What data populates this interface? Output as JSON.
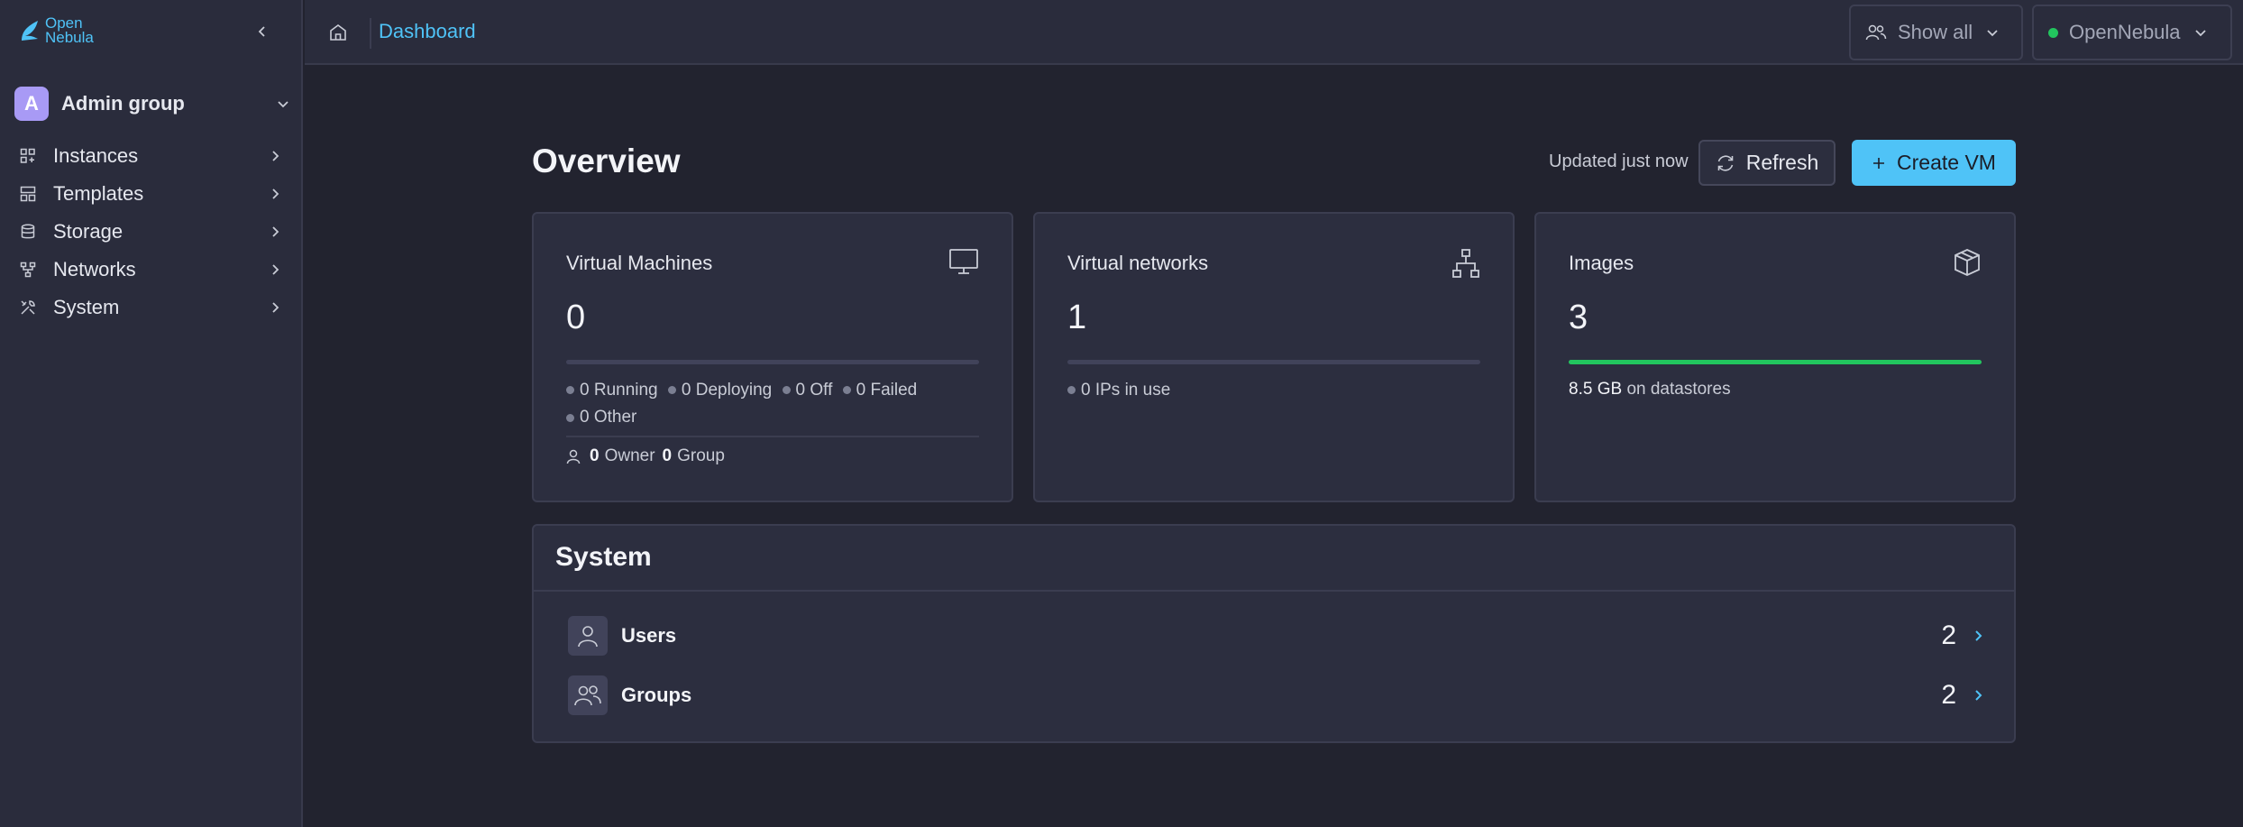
{
  "app": {
    "logo_line1": "Open",
    "logo_line2": "Nebula",
    "brand_color": "#4fc3f7"
  },
  "sidebar": {
    "group": {
      "avatar": "A",
      "name": "Admin group"
    },
    "items": [
      {
        "label": "Instances",
        "icon": "instances-icon"
      },
      {
        "label": "Templates",
        "icon": "templates-icon"
      },
      {
        "label": "Storage",
        "icon": "storage-icon"
      },
      {
        "label": "Networks",
        "icon": "networks-icon"
      },
      {
        "label": "System",
        "icon": "system-icon"
      }
    ]
  },
  "topbar": {
    "breadcrumb": "Dashboard",
    "view_filter": "Show all",
    "zone": "OpenNebula",
    "zone_status_color": "#22c55e"
  },
  "overview": {
    "title": "Overview",
    "updated": "Updated just now",
    "refresh_label": "Refresh",
    "create_label": "Create VM"
  },
  "cards": {
    "vms": {
      "title": "Virtual Machines",
      "count": "0",
      "bar_fill_fraction": 0,
      "states": [
        {
          "label": "0 Running"
        },
        {
          "label": "0 Deploying"
        },
        {
          "label": "0 Off"
        },
        {
          "label": "0 Failed"
        },
        {
          "label": "0 Other"
        }
      ],
      "owner_count": "0",
      "owner_label": "Owner",
      "group_count": "0",
      "group_label": "Group"
    },
    "networks": {
      "title": "Virtual networks",
      "count": "1",
      "bar_fill_fraction": 0,
      "ips": "0 IPs in use"
    },
    "images": {
      "title": "Images",
      "count": "3",
      "bar_fill_fraction": 1,
      "bar_color": "#22c55e",
      "size": "8.5 GB",
      "size_suffix": "on datastores"
    }
  },
  "system": {
    "title": "System",
    "rows": [
      {
        "label": "Users",
        "count": "2"
      },
      {
        "label": "Groups",
        "count": "2"
      }
    ]
  }
}
